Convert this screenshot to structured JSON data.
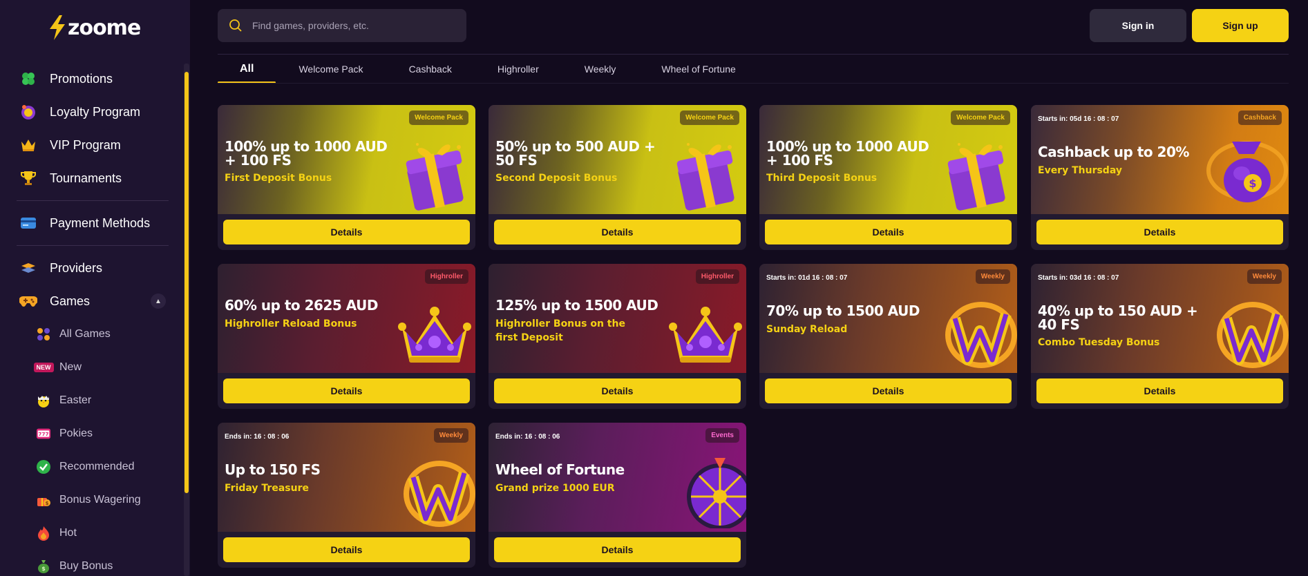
{
  "brand": {
    "name": "zoome",
    "accent": "#f5d214"
  },
  "sidebar": {
    "main_items": [
      {
        "label": "Promotions",
        "icon": "clover-icon"
      },
      {
        "label": "Loyalty Program",
        "icon": "loyalty-coin-icon"
      },
      {
        "label": "VIP Program",
        "icon": "crown-icon"
      },
      {
        "label": "Tournaments",
        "icon": "trophy-icon"
      }
    ],
    "payment": {
      "label": "Payment Methods",
      "icon": "card-icon"
    },
    "providers": {
      "label": "Providers",
      "icon": "providers-icon"
    },
    "games": {
      "label": "Games",
      "icon": "gamepad-icon"
    },
    "game_items": [
      {
        "label": "All Games",
        "icon": "grid-icon"
      },
      {
        "label": "New",
        "icon": "new-badge-icon",
        "badge": "NEW"
      },
      {
        "label": "Easter",
        "icon": "chick-icon"
      },
      {
        "label": "Pokies",
        "icon": "slot-icon",
        "badge": "777"
      },
      {
        "label": "Recommended",
        "icon": "check-icon"
      },
      {
        "label": "Bonus Wagering",
        "icon": "gift-icon"
      },
      {
        "label": "Hot",
        "icon": "fire-icon"
      },
      {
        "label": "Buy Bonus",
        "icon": "money-bag-icon"
      }
    ]
  },
  "header": {
    "search_placeholder": "Find games, providers, etc.",
    "signin_label": "Sign in",
    "signup_label": "Sign up"
  },
  "tabs": [
    "All",
    "Welcome Pack",
    "Cashback",
    "Highroller",
    "Weekly",
    "Wheel of Fortune"
  ],
  "cards": [
    {
      "tag": "Welcome Pack",
      "tag_color": "#f5d214",
      "timer": "",
      "title": "100% up to 1000 AUD + 100 FS",
      "subtitle": "First Deposit Bonus",
      "theme": "yellow",
      "art": "gift",
      "button": "Details"
    },
    {
      "tag": "Welcome Pack",
      "tag_color": "#f5d214",
      "timer": "",
      "title": "50% up to 500 AUD + 50 FS",
      "subtitle": "Second Deposit Bonus",
      "theme": "yellow",
      "art": "gift",
      "button": "Details"
    },
    {
      "tag": "Welcome Pack",
      "tag_color": "#f5d214",
      "timer": "",
      "title": "100% up to 1000 AUD + 100 FS",
      "subtitle": "Third Deposit Bonus",
      "theme": "yellow",
      "art": "gift",
      "button": "Details"
    },
    {
      "tag": "Cashback",
      "tag_color": "#f5a524",
      "timer": "Starts in: 05d 16 : 08 : 07",
      "title": "Cashback up to 20%",
      "subtitle": "Every Thursday",
      "theme": "orange",
      "art": "bag",
      "button": "Details"
    },
    {
      "tag": "Highroller",
      "tag_color": "#ff5a6a",
      "timer": "",
      "title": "60% up to 2625 AUD",
      "subtitle": "Highroller Reload Bonus",
      "theme": "red",
      "art": "crown",
      "button": "Details"
    },
    {
      "tag": "Highroller",
      "tag_color": "#ff5a6a",
      "timer": "",
      "title": "125% up to 1500 AUD",
      "subtitle": "Highroller Bonus on the first Deposit",
      "theme": "red",
      "art": "crown",
      "button": "Details"
    },
    {
      "tag": "Weekly",
      "tag_color": "#ff8a3a",
      "timer": "Starts in: 01d 16 : 08 : 07",
      "title": "70% up to 1500 AUD",
      "subtitle": "Sunday Reload",
      "theme": "orange2",
      "art": "w",
      "button": "Details"
    },
    {
      "tag": "Weekly",
      "tag_color": "#ff8a3a",
      "timer": "Starts in: 03d 16 : 08 : 07",
      "title": "40% up to 150 AUD + 40 FS",
      "subtitle": "Combo Tuesday Bonus",
      "theme": "orange2",
      "art": "w",
      "button": "Details"
    },
    {
      "tag": "Weekly",
      "tag_color": "#ff8a3a",
      "timer": "Ends in: 16 : 08 : 06",
      "title": "Up to 150 FS",
      "subtitle": "Friday Treasure",
      "theme": "orange2",
      "art": "w",
      "button": "Details"
    },
    {
      "tag": "Events",
      "tag_color": "#ff6ad0",
      "timer": "Ends in: 16 : 08 : 06",
      "title": "Wheel of Fortune",
      "subtitle": "Grand prize 1000 EUR",
      "theme": "purple",
      "art": "wheel",
      "button": "Details"
    }
  ]
}
